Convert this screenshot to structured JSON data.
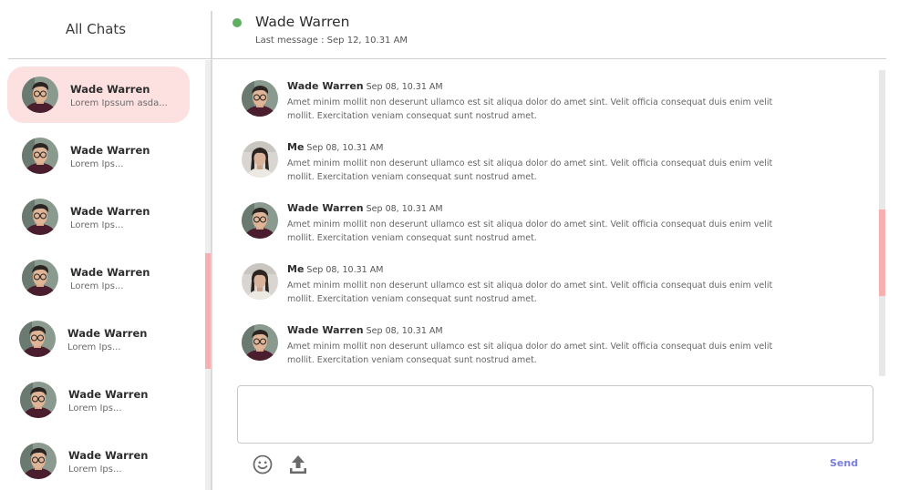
{
  "sidebar": {
    "title": "All Chats",
    "chats": [
      {
        "name": "Wade Warren",
        "preview": "Lorem Ipssum asda...",
        "active": true
      },
      {
        "name": "Wade Warren",
        "preview": "Lorem Ips...",
        "active": false
      },
      {
        "name": "Wade Warren",
        "preview": "Lorem Ips...",
        "active": false
      },
      {
        "name": "Wade Warren",
        "preview": "Lorem Ips...",
        "active": false
      },
      {
        "name": "Wade Warren",
        "preview": "Lorem Ips...",
        "active": false
      },
      {
        "name": "Wade Warren",
        "preview": "Lorem Ips...",
        "active": false
      },
      {
        "name": "Wade Warren",
        "preview": "Lorem Ips...",
        "active": false
      }
    ]
  },
  "header": {
    "contact_name": "Wade Warren",
    "status": "online",
    "status_color": "#5fae62",
    "last_message": "Last message : Sep 12, 10.31 AM"
  },
  "messages": [
    {
      "sender": "Wade Warren",
      "time": "Sep 08, 10.31 AM",
      "avatar": "wade",
      "text": "Amet minim mollit non deserunt ullamco est sit aliqua dolor do amet sint. Velit officia consequat duis enim velit mollit. Exercitation veniam consequat sunt nostrud amet."
    },
    {
      "sender": "Me",
      "time": "Sep 08, 10.31 AM",
      "avatar": "me",
      "text": "Amet minim mollit non deserunt ullamco est sit aliqua dolor do amet sint. Velit officia consequat duis enim velit mollit. Exercitation veniam consequat sunt nostrud amet."
    },
    {
      "sender": "Wade Warren",
      "time": "Sep 08, 10.31 AM",
      "avatar": "wade",
      "text": "Amet minim mollit non deserunt ullamco est sit aliqua dolor do amet sint. Velit officia consequat duis enim velit mollit. Exercitation veniam consequat sunt nostrud amet."
    },
    {
      "sender": "Me",
      "time": "Sep 08, 10.31 AM",
      "avatar": "me",
      "text": "Amet minim mollit non deserunt ullamco est sit aliqua dolor do amet sint. Velit officia consequat duis enim velit mollit. Exercitation veniam consequat sunt nostrud amet."
    },
    {
      "sender": "Wade Warren",
      "time": "Sep 08, 10.31 AM",
      "avatar": "wade",
      "text": "Amet minim mollit non deserunt ullamco est sit aliqua dolor do amet sint. Velit officia consequat duis enim velit mollit. Exercitation veniam consequat sunt nostrud amet."
    }
  ],
  "composer": {
    "value": "",
    "emoji_icon": "smiley-icon",
    "upload_icon": "upload-icon",
    "send_label": "Send"
  },
  "colors": {
    "accent_pink": "#f6b0b0",
    "active_chat_bg": "#fde1e1",
    "send": "#7b7fdc"
  }
}
